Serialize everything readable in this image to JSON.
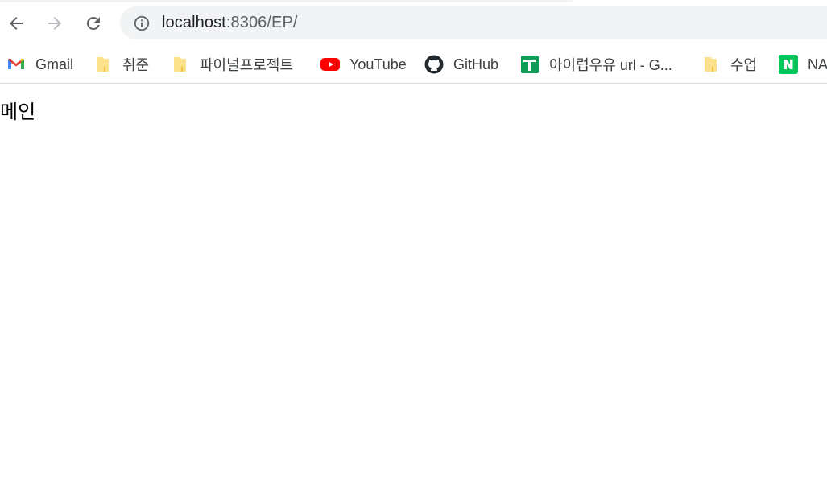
{
  "toolbar": {
    "back_label": "",
    "url_host": "localhost",
    "url_rest": ":8306/EP/"
  },
  "bookmarks": [
    {
      "label": "Gmail",
      "icon": "gmail-icon"
    },
    {
      "label": "취준",
      "icon": "folder-icon"
    },
    {
      "label": "파이널프로젝트",
      "icon": "folder-icon"
    },
    {
      "label": "YouTube",
      "icon": "youtube-icon"
    },
    {
      "label": "GitHub",
      "icon": "github-icon"
    },
    {
      "label": "아이럽우유 url - G...",
      "icon": "google-sheets-icon"
    },
    {
      "label": "수업",
      "icon": "folder-icon"
    },
    {
      "label": "NA",
      "icon": "naver-icon"
    }
  ],
  "page": {
    "text": "메인"
  },
  "colors": {
    "omnibox_bg": "#f1f3f4",
    "folder": "#fbe18a",
    "youtube_red": "#ff0000",
    "sheets_green": "#0f9d58",
    "naver_green": "#03c75a"
  }
}
